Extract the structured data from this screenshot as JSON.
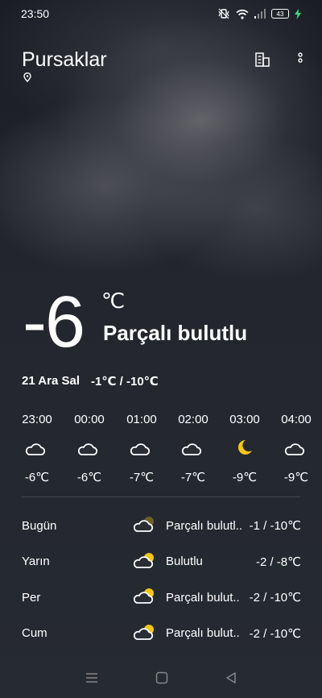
{
  "status": {
    "time": "23:50",
    "battery": "43"
  },
  "header": {
    "city": "Pursaklar"
  },
  "current": {
    "temp": "-6",
    "unit": "℃",
    "condition": "Parçalı bulutlu"
  },
  "date_line": {
    "date": "21 Ara Sal",
    "range": "-1℃ / -10℃"
  },
  "hourly": [
    {
      "time": "23:00",
      "icon": "partly-cloudy-night-icon",
      "temp": "-6℃"
    },
    {
      "time": "00:00",
      "icon": "partly-cloudy-night-icon",
      "temp": "-6℃"
    },
    {
      "time": "01:00",
      "icon": "partly-cloudy-night-icon",
      "temp": "-7℃"
    },
    {
      "time": "02:00",
      "icon": "partly-cloudy-night-icon",
      "temp": "-7℃"
    },
    {
      "time": "03:00",
      "icon": "moon-icon",
      "temp": "-9℃"
    },
    {
      "time": "04:00",
      "icon": "partly-cloudy-night-icon",
      "temp": "-9℃"
    }
  ],
  "daily": [
    {
      "day": "Bugün",
      "icon": "partly-cloudy-icon",
      "desc": "Parçalı bulutl..",
      "range": "-1 / -10℃"
    },
    {
      "day": "Yarın",
      "icon": "cloudy-sun-icon",
      "desc": "Bulutlu",
      "range": "-2 / -8℃"
    },
    {
      "day": "Per",
      "icon": "cloudy-sun-icon",
      "desc": "Parçalı bulut..",
      "range": "-2 / -10℃"
    },
    {
      "day": "Cum",
      "icon": "cloudy-sun-icon",
      "desc": "Parçalı bulut..",
      "range": "-2 / -10℃"
    }
  ],
  "colors": {
    "accent_sun": "#f5c518",
    "background": "#25282f",
    "charging": "#3ddc84"
  }
}
